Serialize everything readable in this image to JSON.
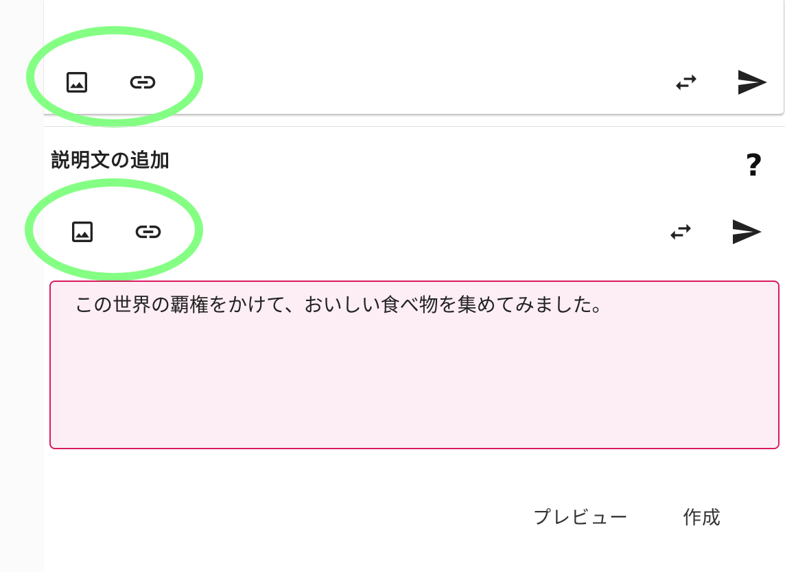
{
  "top_toolbar": {
    "left_icons": [
      "image-icon",
      "link-icon"
    ],
    "right_icons": [
      "swap-icon",
      "send-icon"
    ]
  },
  "description_section": {
    "title": "説明文の追加",
    "help_label": "?",
    "toolbar": {
      "left_icons": [
        "image-icon",
        "link-icon"
      ],
      "right_icons": [
        "swap-icon",
        "send-icon"
      ]
    },
    "textarea_value": "この世界の覇権をかけて、おいしい食べ物を集めてみました。"
  },
  "actions": {
    "preview_label": "プレビュー",
    "create_label": "作成"
  },
  "colors": {
    "highlight": "#7dff7d",
    "textarea_border": "#d81b60",
    "textarea_background": "#fdeef5"
  }
}
